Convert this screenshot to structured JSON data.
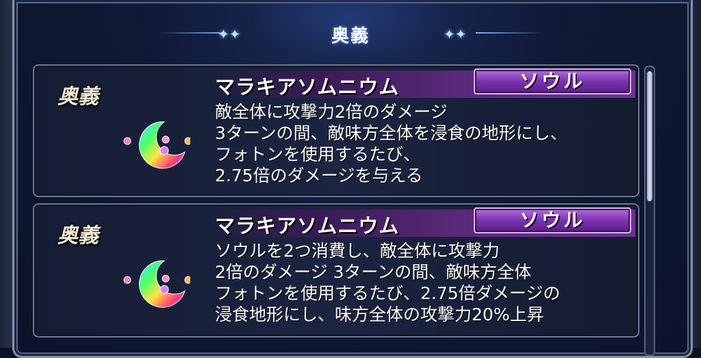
{
  "header": {
    "title": "奥義"
  },
  "cards": [
    {
      "label": "奥義",
      "name": "マラキアソムニウム",
      "type": "ソウル",
      "icon": "crescent-moon-orbs-icon",
      "description": [
        "敵全体に攻撃力2倍のダメージ",
        "3ターンの間、敵味方全体を浸食の地形にし、",
        "フォトンを使用するたび、",
        "2.75倍のダメージを与える"
      ]
    },
    {
      "label": "奥義",
      "name": "マラキアソムニウム",
      "type": "ソウル",
      "icon": "crescent-moon-orbs-icon",
      "description": [
        "ソウルを2つ消費し、敵全体に攻撃力",
        "2倍のダメージ 3ターンの間、敵味方全体",
        "フォトンを使用するたび、2.75倍ダメージの",
        "浸食地形にし、味方全体の攻撃力20%上昇"
      ]
    }
  ],
  "colors": {
    "badge": "#7a34ae",
    "accent": "#7fb3ff",
    "background": "#0b1226"
  }
}
